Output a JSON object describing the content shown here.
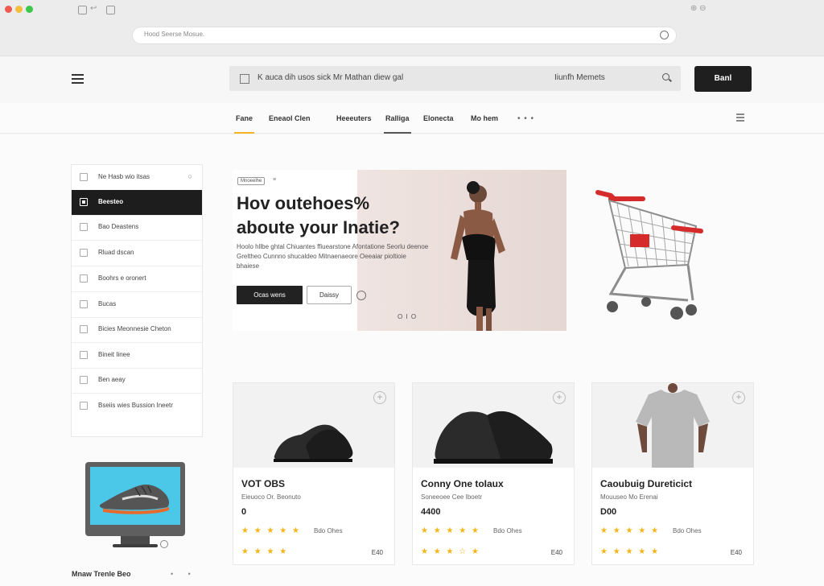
{
  "browser": {
    "url": "Hood Seerse Mosue.",
    "toolbar_text": "⇤ ⊖",
    "ext_icon": "⊕ ⊖"
  },
  "header": {
    "search_text": "K auca dih usos sick Mr Mathan diew gal",
    "search_category": "Iiunfh Memets",
    "button_label": "Banl"
  },
  "nav": {
    "items": [
      "Fane",
      "Eneaol Clen",
      "Heeeuters",
      "Ralliga",
      "Elonecta",
      "Mo hem"
    ],
    "more": "• • •"
  },
  "sidebar": {
    "items": [
      {
        "label": "Ne Hasb wio itsas",
        "active": false
      },
      {
        "label": "Beesteo",
        "active": true
      },
      {
        "label": "Bao Deastens",
        "active": false
      },
      {
        "label": "Rluad dscan",
        "active": false
      },
      {
        "label": "Boohrs e oronert",
        "active": false
      },
      {
        "label": "Bucas",
        "active": false
      },
      {
        "label": "Bicies Meonnesie Cheton",
        "active": false
      },
      {
        "label": "Bineit Iinee",
        "active": false
      },
      {
        "label": "Ben aeay",
        "active": false
      },
      {
        "label": "Bseiis wies Bussion Ineetr",
        "active": false
      }
    ],
    "footer": "Mnaw Trenle Beo",
    "footer_dots": "• •"
  },
  "hero": {
    "badge": "Mnoeelhe",
    "badge2": "≡",
    "title": "Hov outehoes%\naboute your Inatie?",
    "desc": "Hoolo hllbe ghtal Chiuantes ffiuearstone Afontatione Seorlu deenoe Greltheo Cunnno shucaldeo Mitnaenaeore Oeeaiar pioltioie bhaiese",
    "button_primary": "Ocas wens",
    "button_secondary": "Daissy",
    "dots": "O I O"
  },
  "products": [
    {
      "title": "VOT OBS",
      "sub": "Eieuoco Or. Beonuto",
      "price": "0",
      "reviews": "Bdo Ohes",
      "count": "E40",
      "stars1": "★ ★ ★ ★ ★",
      "stars2": "★ ★ ★   ★"
    },
    {
      "title": "Conny One toIaux",
      "sub": "Soneeoee Cee Iboetr",
      "price": "4400",
      "reviews": "Bdo Ohes",
      "count": "E40",
      "stars1": "★ ★ ★ ★ ★",
      "stars2": "★ ★ ★ ☆ ★"
    },
    {
      "title": "Caoubuig Dureticict",
      "sub": "Mouuseo Mo Erenai",
      "price": "D00",
      "reviews": "Bdo Ohes",
      "count": "E40",
      "stars1": "★ ★ ★ ★ ★",
      "stars2": "★ ★ ★ ★ ★"
    }
  ],
  "colors": {
    "accent": "#f3b325",
    "dark": "#1f1f1f",
    "star": "#f4b41a",
    "cart_handle": "#d52b2b"
  }
}
